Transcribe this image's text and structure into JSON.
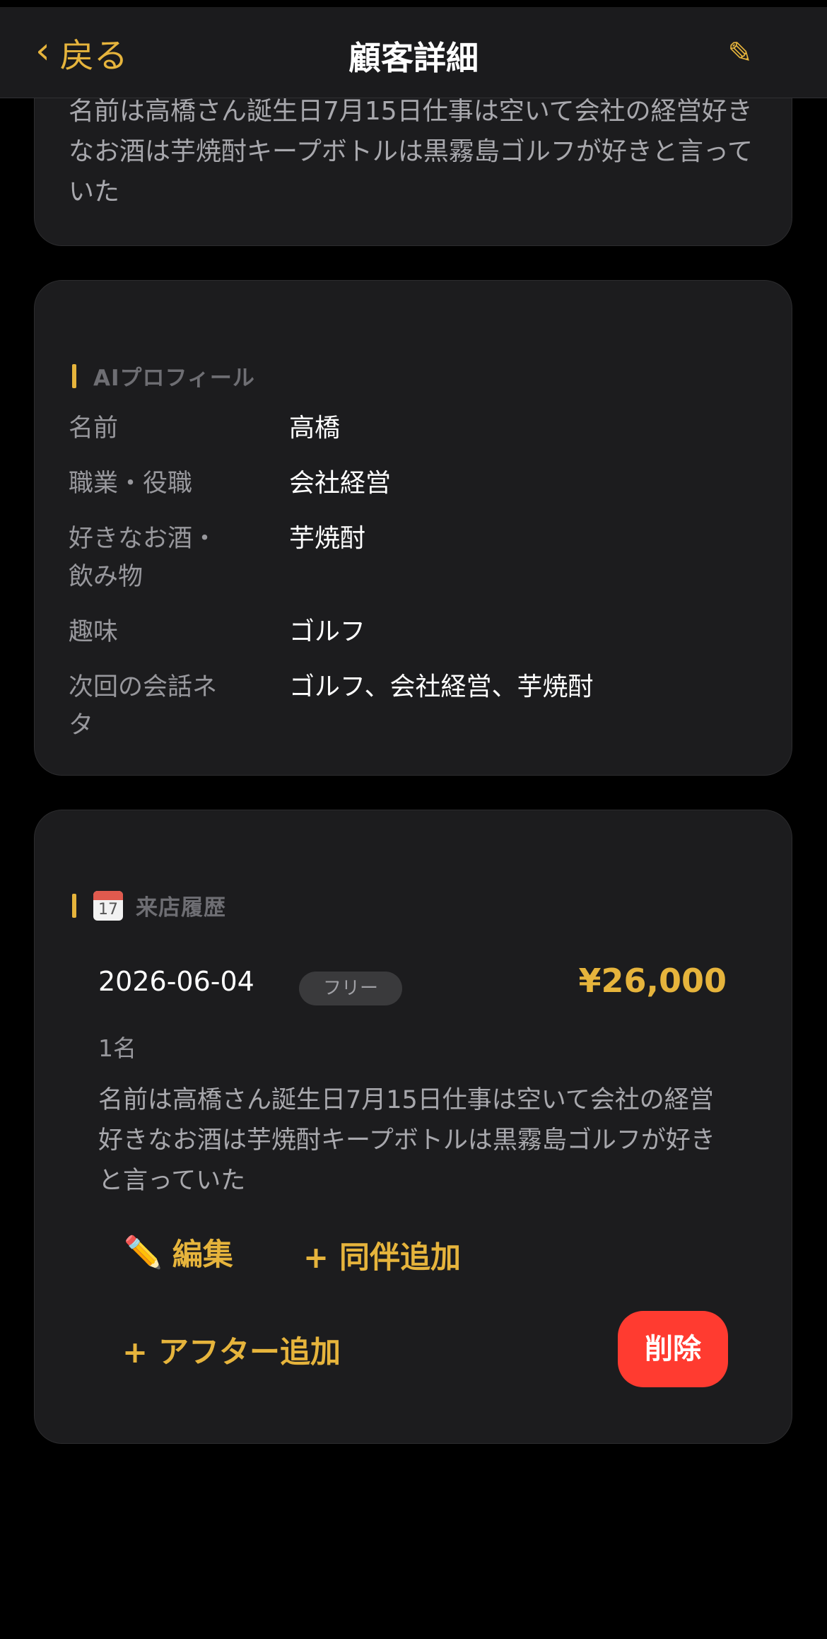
{
  "nav": {
    "back_label": "戻る",
    "title": "顧客詳細",
    "edit_glyph": "✎"
  },
  "memo": {
    "text": "名前は高橋さん誕生日7月15日仕事は空いて会社の経営好きなお酒は芋焼酎キープボトルは黒霧島ゴルフが好きと言っていた"
  },
  "profile": {
    "section_title": "AIプロフィール",
    "rows": [
      {
        "label": "名前",
        "value": "高橋"
      },
      {
        "label": "職業・役職",
        "value": "会社経営"
      },
      {
        "label": "好きなお酒・飲み物",
        "value": "芋焼酎"
      },
      {
        "label": "趣味",
        "value": "ゴルフ"
      },
      {
        "label": "次回の会話ネタ",
        "value": "ゴルフ、会社経営、芋焼酎"
      }
    ]
  },
  "visits": {
    "section_title": "来店履歴",
    "calendar_day": "17",
    "items": [
      {
        "date": "2026-06-04",
        "badge": "フリー",
        "amount": "¥26,000",
        "guests": "1名",
        "memo": "名前は高橋さん誕生日7月15日仕事は空いて会社の経営好きなお酒は芋焼酎キープボトルは黒霧島ゴルフが好きと言っていた",
        "edit_label": "編集",
        "add_companion_label": "+ 同伴追加",
        "add_after_label": "+ アフター追加",
        "delete_label": "削除"
      }
    ]
  },
  "colors": {
    "accent": "#e6b43c",
    "danger": "#ff3b30",
    "card_bg": "#1c1c1e",
    "background": "#000000"
  }
}
